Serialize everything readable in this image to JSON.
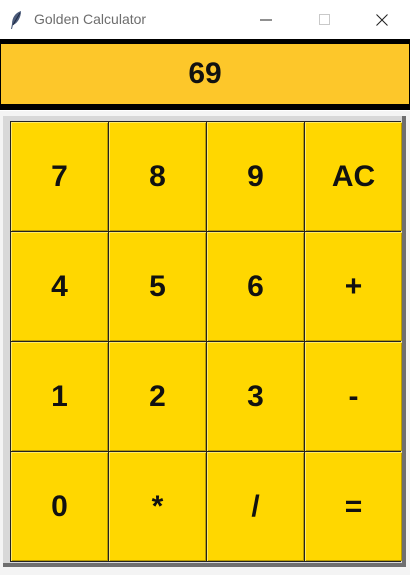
{
  "window": {
    "title": "Golden Calculator",
    "icon": "feather-icon"
  },
  "display": {
    "value": "69"
  },
  "keypad": {
    "keys": [
      "7",
      "8",
      "9",
      "AC",
      "4",
      "5",
      "6",
      "+",
      "1",
      "2",
      "3",
      "-",
      "0",
      "*",
      "/",
      "="
    ]
  },
  "colors": {
    "display_bg": "#fdc72a",
    "key_bg": "#ffd700",
    "text": "#111111"
  }
}
